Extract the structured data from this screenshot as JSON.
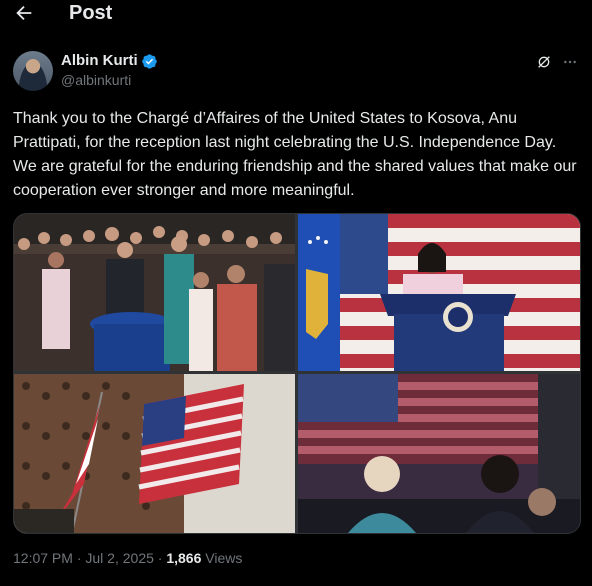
{
  "header": {
    "title": "Post"
  },
  "author": {
    "name": "Albin Kurti",
    "handle": "@albinkurti"
  },
  "tweet": {
    "text": "Thank you to the Chargé d’Affaires of the United States to Kosova, Anu Prattipati, for the reception last night celebrating the U.S. Independence Day. We are grateful for the enduring friendship and the shared values that make our cooperation ever stronger and more meaningful."
  },
  "meta": {
    "time": "12:07 PM",
    "separator": "·",
    "date": "Jul 2, 2025",
    "views_count": "1,866",
    "views_label": "Views"
  },
  "icons": {
    "back": "arrow-left-icon",
    "verified": "verified-badge-icon",
    "grok": "grok-icon",
    "more": "more-dots-icon"
  },
  "colors": {
    "background": "#000000",
    "text": "#e7e9ea",
    "muted": "#71767b",
    "verified": "#1d9bf0"
  }
}
